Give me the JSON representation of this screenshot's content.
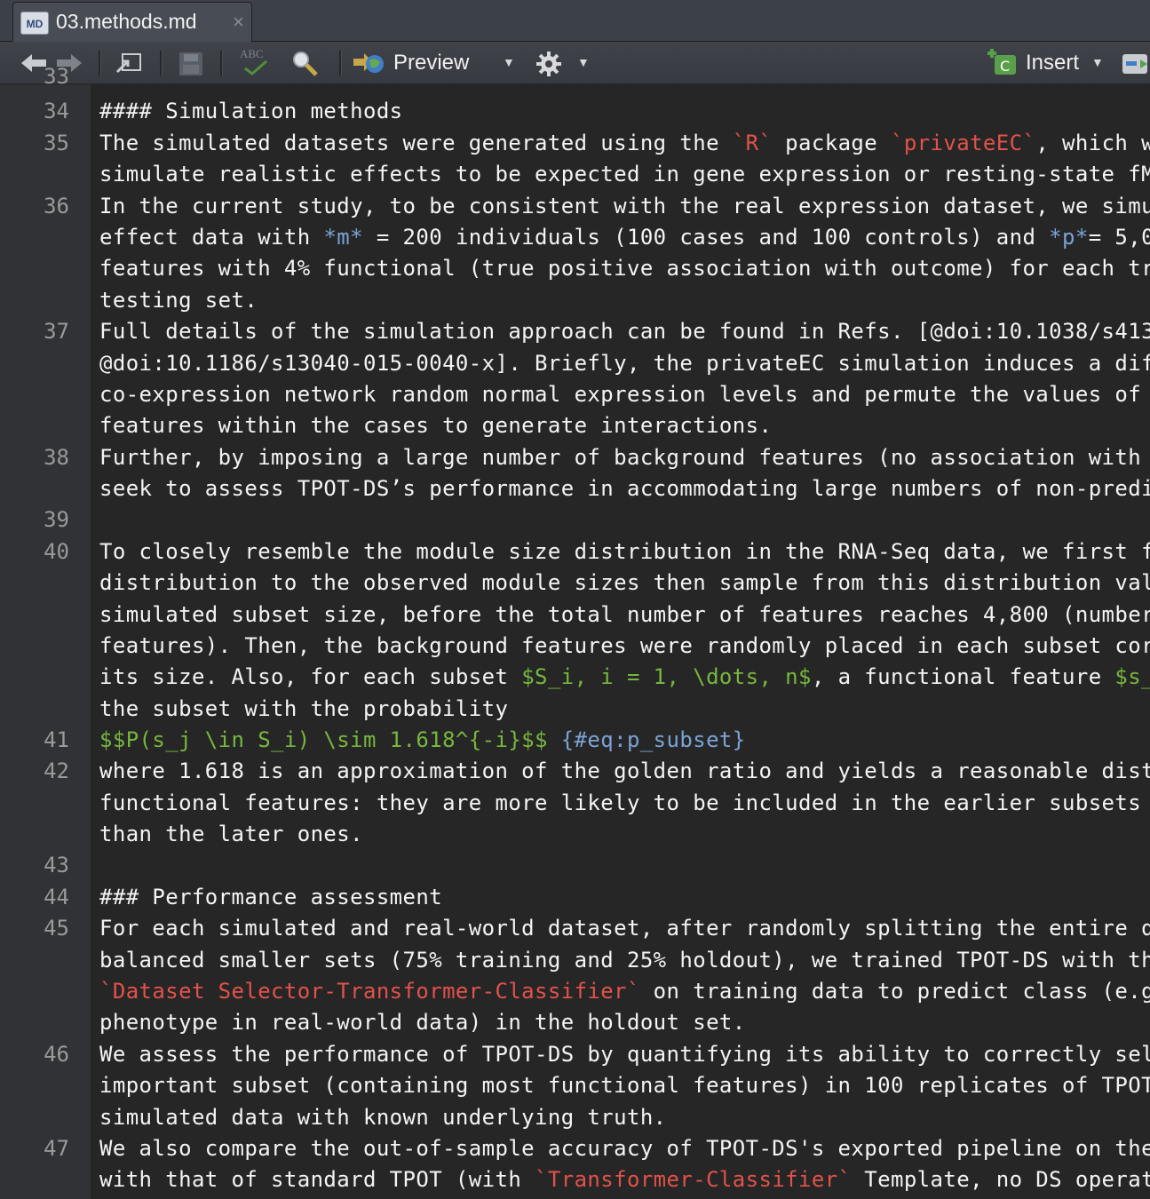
{
  "tab": {
    "icon_label": "MD",
    "title": "03.methods.md",
    "close": "×"
  },
  "toolbar": {
    "spell_label": "ABC",
    "preview_label": "Preview",
    "insert_label": "Insert",
    "icons": [
      "back-arrow-icon",
      "forward-arrow-icon",
      "show-in-window-icon",
      "save-icon",
      "spellcheck-icon",
      "search-icon",
      "preview-icon",
      "gear-icon",
      "insert-chunk-icon",
      "run-chunk-icon"
    ]
  },
  "editor": {
    "gutter": {
      "n33": "33",
      "n34": "34",
      "n35": "35",
      "n36": "36",
      "n37": "37",
      "n38": "38",
      "n39": "39",
      "n40": "40",
      "n41": "41",
      "n42": "42",
      "n43": "43",
      "n44": "44",
      "n45": "45",
      "n46": "46",
      "n47": "47"
    },
    "l34": "#### Simulation methods",
    "l35a": "The simulated datasets were generated using the ",
    "l35b": "`R`",
    "l35c": " package ",
    "l35d": "`privateEC`",
    "l35e": ", which w",
    "l35_2": "simulate realistic effects to be expected in gene expression or resting-state fM",
    "l36": "In the current study, to be consistent with the real expression dataset, we simu",
    "l36_2a": "effect data with ",
    "l36_2b": "*m*",
    "l36_2c": " = 200 individuals (100 cases and 100 controls) and ",
    "l36_2d": "*p*",
    "l36_2e": "= 5,00",
    "l36_3": "features with 4% functional (true positive association with outcome) for each tr",
    "l36_4": "testing set.",
    "l37": "Full details of the simulation approach can be found in Refs. [@doi:10.1038/s413",
    "l37_2": "@doi:10.1186/s13040-015-0040-x]. Briefly, the privateEC simulation induces a dif",
    "l37_3": "co-expression network random normal expression levels and permute the values of",
    "l37_4": "features within the cases to generate interactions.",
    "l38": "Further, by imposing a large number of background features (no association with",
    "l38_2": "seek to assess TPOT-DS’s performance in accommodating large numbers of non-predi",
    "l40": "To closely resemble the module size distribution in the RNA-Seq data, we first f",
    "l40_2": "distribution to the observed module sizes then sample from this distribution val",
    "l40_3": "simulated subset size, before the total number of features reaches 4,800 (number",
    "l40_4": "features). Then, the background features were randomly placed in each subset cor",
    "l40_5a": "its size. Also, for each subset ",
    "l40_5b": "$S_i, i = 1, \\dots, n$",
    "l40_5c": ", a functional feature ",
    "l40_5d": "$s_",
    "l40_6": "the subset with the probability",
    "l41a": "$$P(s_j \\in S_i) \\sim 1.618^{-i}$$",
    "l41b": " {#eq:p_subset}",
    "l42": "where 1.618 is an approximation of the golden ratio and yields a reasonable dist",
    "l42_2": "functional features: they are more likely to be included in the earlier subsets",
    "l42_3": "than the later ones.",
    "l44": "### Performance assessment",
    "l45": "For each simulated and real-world dataset, after randomly splitting the entire d",
    "l45_2": "balanced smaller sets (75% training and 25% holdout), we trained TPOT-DS with th",
    "l45_3a": "`Dataset Selector-Transformer-Classifier`",
    "l45_3b": " on training data to predict class (e.g",
    "l45_4": "phenotype in real-world data) in the holdout set.",
    "l46": "We assess the performance of TPOT-DS by quantifying its ability to correctly sel",
    "l46_2": "important subset (containing most functional features) in 100 replicates of TPOT",
    "l46_3": "simulated data with known underlying truth.",
    "l47": "We also compare the out-of-sample accuracy of TPOT-DS's exported pipeline on the",
    "l47_2a": "with that of standard TPOT (with ",
    "l47_2b": "`Transformer-Classifier`",
    "l47_2c": " Template, no DS operat"
  }
}
